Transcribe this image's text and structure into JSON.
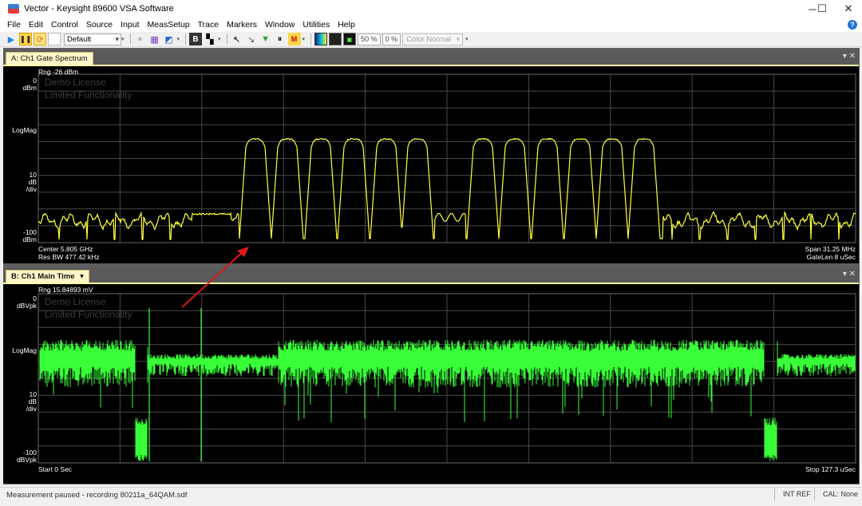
{
  "window": {
    "title": "Vector - Keysight 89600 VSA Software",
    "minimize": "─",
    "maximize": "☐",
    "close": "✕"
  },
  "menu": [
    "File",
    "Edit",
    "Control",
    "Source",
    "Input",
    "MeasSetup",
    "Trace",
    "Markers",
    "Window",
    "Utilities",
    "Help"
  ],
  "toolbar": {
    "layout_value": "Default",
    "percent_a": "50 %",
    "percent_b": "0 %",
    "color_scheme": "Color Normal"
  },
  "pane_a": {
    "tab_label": "A: Ch1 Gate Spectrum",
    "range": "Rng -26 dBm",
    "ref_value": "0",
    "ref_unit": "dBm",
    "format": "LogMag",
    "scale_value": "10",
    "scale_unit": "dB",
    "scale_per": "/div",
    "bottom_value": "-100",
    "bottom_unit": "dBm",
    "x_left_1": "Center 5.805 GHz",
    "x_left_2": "Res BW 477.42 kHz",
    "x_right_1": "Span 31.25 MHz",
    "x_right_2": "GateLen 8 uSec",
    "watermark_1": "Demo License",
    "watermark_2": "Limited Functionality",
    "trace_color": "#ffff3a"
  },
  "pane_b": {
    "tab_label": "B: Ch1 Main Time",
    "tab_dropdown": "▾",
    "range": "Rng 15.84893 mV",
    "ref_value": "0",
    "ref_unit": "dBVpk",
    "format": "LogMag",
    "scale_value": "10",
    "scale_unit": "dB",
    "scale_per": "/div",
    "bottom_value": "-100",
    "bottom_unit": "dBVpk",
    "x_left": "Start 0  Sec",
    "x_right": "Stop 127.3 uSec",
    "watermark_1": "Demo License",
    "watermark_2": "Limited Functionality",
    "trace_color": "#38ff38"
  },
  "annotation": {
    "arrow_color": "#e01818"
  },
  "status": {
    "message": "Measurement paused - recording 80211a_64QAM.sdf",
    "ref": "INT REF",
    "cal": "CAL: None"
  }
}
